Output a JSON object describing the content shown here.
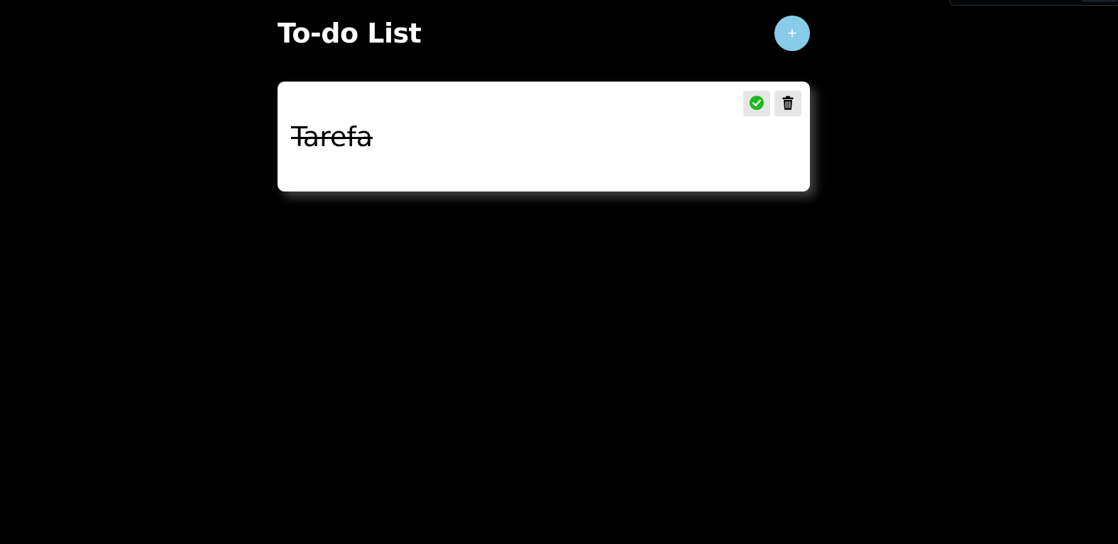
{
  "header": {
    "title": "To-do List",
    "add_button_label": "+",
    "add_button_color": "#87cdea"
  },
  "tasks": [
    {
      "text": "Tarefa",
      "completed": true,
      "complete_icon": "check-circle-icon",
      "complete_icon_color": "#1db81d",
      "delete_icon": "trash-icon"
    }
  ]
}
